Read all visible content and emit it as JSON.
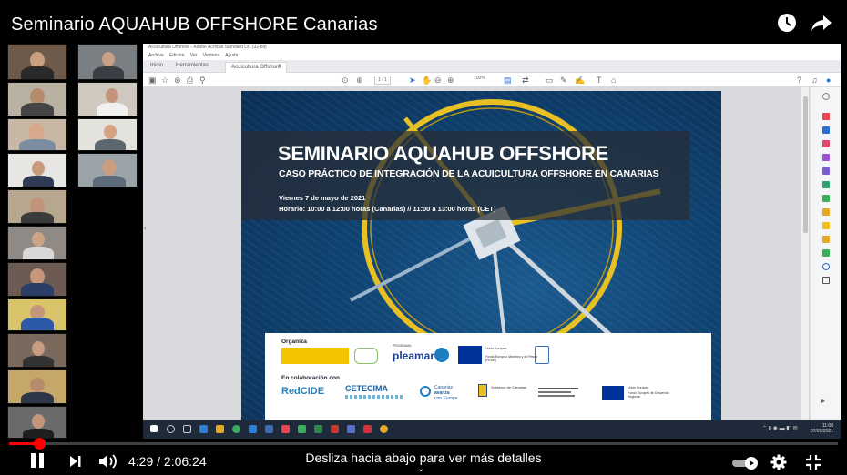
{
  "video": {
    "title": "Seminario AQUAHUB OFFSHORE Canarias",
    "time_current": "4:29",
    "time_total": "2:06:24",
    "time_display": "4:29 / 2:06:24",
    "scroll_hint": "Desliza hacia abajo para ver más detalles",
    "progress_fraction": 0.036
  },
  "acrobat": {
    "window_title": "Acuicultura Offshore - Adobe Acrobat Standard DC (32-bit)",
    "menu": [
      "Archivo",
      "Edición",
      "Ver",
      "Ventana",
      "Ayuda"
    ],
    "tabs": [
      "Inicio",
      "Herramientas",
      "Acuicultura Offshore"
    ],
    "page_indicator": "1 / 1",
    "zoom": "100%"
  },
  "slide": {
    "title": "SEMINARIO AQUAHUB OFFSHORE",
    "subtitle": "CASO PRÁCTICO DE INTEGRACIÓN DE LA ACUICULTURA OFFSHORE EN CANARIAS",
    "date": "Viernes 7 de mayo de 2021",
    "schedule": "Horario: 10:00 a 12:00 horas (Canarias) // 11:00 a 13:00 horas (CET)",
    "organiza_label": "Organiza",
    "colaboracion_label": "En colaboración con",
    "logos": {
      "pleamar_top": "PROGRAMA",
      "pleamar": "pleamar",
      "union_europea": "Unión Europea",
      "femp": "Fondo Europeo Marítimo y de Pesca (FEMP)",
      "redcide": "RedCIDE",
      "cetecima": "CETECIMA",
      "canarias_avanza_1": "Canarias",
      "canarias_avanza_2": "avanza",
      "canarias_avanza_3": "con Europa",
      "gobierno_canarias": "Gobierno de Canarias",
      "feder_top": "Unión Europea",
      "feder": "Fondo Europeo de Desarrollo Regional"
    }
  },
  "taskbar": {
    "clock_time": "11:00",
    "clock_date": "07/05/2021"
  },
  "colors": {
    "progress": "#ff0000",
    "slide_overlay": "#282c34",
    "cage_yellow": "#e8c024",
    "sea": "#0f4372"
  }
}
